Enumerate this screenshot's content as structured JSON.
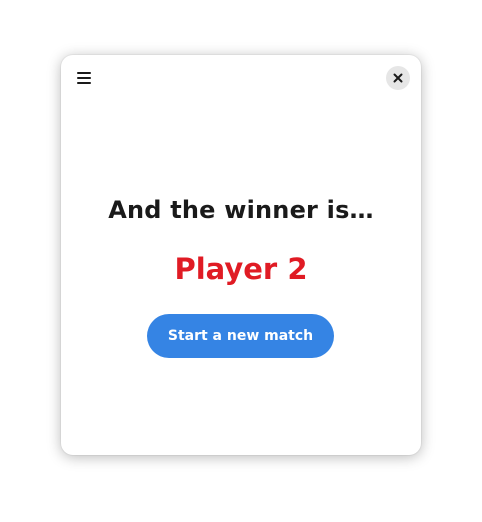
{
  "dialog": {
    "heading": "And the winner is…",
    "winner_name": "Player 2",
    "new_match_label": "Start a new match"
  },
  "icons": {
    "menu": "hamburger-menu-icon",
    "close": "close-icon"
  },
  "colors": {
    "winner_text": "#e01b24",
    "button_background": "#3584e4",
    "button_text": "#ffffff",
    "heading_text": "#1a1a1a",
    "close_button_background": "#e6e6e6"
  }
}
